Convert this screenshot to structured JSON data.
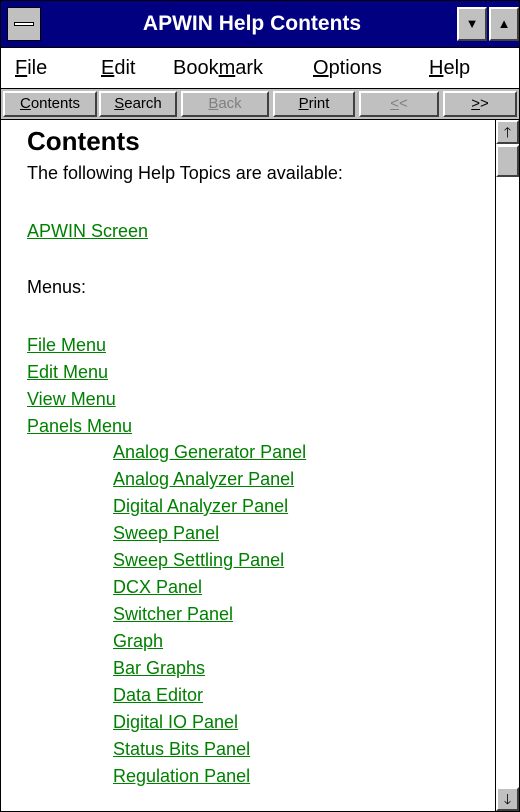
{
  "window": {
    "title": "APWIN Help Contents"
  },
  "menubar": {
    "items": [
      {
        "pre": "",
        "ul": "F",
        "post": "ile"
      },
      {
        "pre": "",
        "ul": "E",
        "post": "dit"
      },
      {
        "pre": "Book",
        "ul": "m",
        "post": "ark"
      },
      {
        "pre": "",
        "ul": "O",
        "post": "ptions"
      },
      {
        "pre": "",
        "ul": "H",
        "post": "elp"
      }
    ]
  },
  "buttons": {
    "contents": {
      "ul": "C",
      "post": "ontents"
    },
    "search": {
      "ul": "S",
      "post": "earch"
    },
    "back": {
      "ul": "B",
      "post": "ack"
    },
    "print": {
      "ul": "P",
      "post": "rint"
    },
    "prev": {
      "ul": "<",
      "post": "<"
    },
    "next": {
      "ul": ">",
      "post": ">"
    }
  },
  "content": {
    "heading": "Contents",
    "intro": "The following Help Topics are available:",
    "screen_link": "APWIN Screen",
    "menus_label": "Menus:",
    "menu_links": [
      "File Menu",
      "Edit Menu",
      "View Menu",
      "Panels Menu"
    ],
    "panel_links": [
      "Analog Generator Panel",
      "Analog Analyzer Panel",
      "Digital Analyzer Panel",
      "Sweep Panel",
      "Sweep Settling Panel",
      "DCX Panel",
      "Switcher Panel",
      "Graph",
      "Bar Graphs",
      "Data Editor",
      "Digital IO Panel",
      "Status Bits Panel",
      "Regulation Panel"
    ]
  },
  "colors": {
    "titlebar": "#000080",
    "link": "#008000",
    "chrome": "#c0c0c0"
  }
}
